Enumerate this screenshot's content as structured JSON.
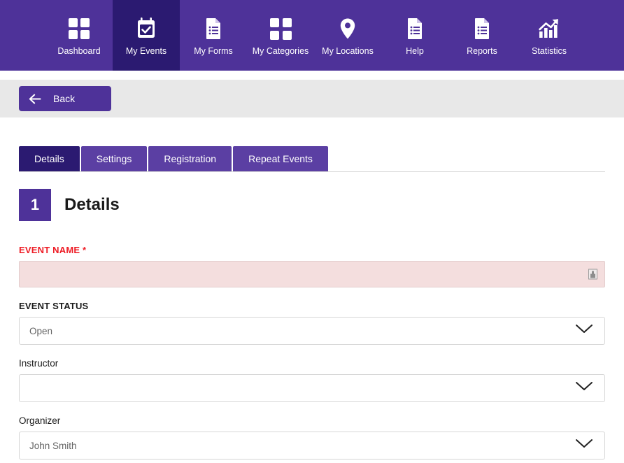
{
  "nav": {
    "items": [
      {
        "label": "Dashboard",
        "icon": "grid-icon",
        "active": false
      },
      {
        "label": "My Events",
        "icon": "calendar-check-icon",
        "active": true
      },
      {
        "label": "My Forms",
        "icon": "document-list-icon",
        "active": false
      },
      {
        "label": "My Categories",
        "icon": "grid-icon",
        "active": false
      },
      {
        "label": "My Locations",
        "icon": "map-pin-icon",
        "active": false
      },
      {
        "label": "Help",
        "icon": "document-list-icon",
        "active": false
      },
      {
        "label": "Reports",
        "icon": "document-list-icon",
        "active": false
      },
      {
        "label": "Statistics",
        "icon": "bar-chart-arrow-icon",
        "active": false
      }
    ]
  },
  "toolbar": {
    "back_label": "Back",
    "back_icon": "arrow-left-icon"
  },
  "tabs": [
    {
      "label": "Details",
      "active": true
    },
    {
      "label": "Settings",
      "active": false
    },
    {
      "label": "Registration",
      "active": false
    },
    {
      "label": "Repeat Events",
      "active": false
    }
  ],
  "section": {
    "number": "1",
    "title": "Details"
  },
  "form": {
    "event_name": {
      "label": "EVENT NAME",
      "required_marker": "*",
      "value": "",
      "placeholder": "",
      "icon": "image-placeholder-icon"
    },
    "event_status": {
      "label": "EVENT STATUS",
      "value": "Open",
      "icon": "chevron-down-icon"
    },
    "instructor": {
      "label": "Instructor",
      "value": "",
      "icon": "chevron-down-icon"
    },
    "organizer": {
      "label": "Organizer",
      "value": "John Smith",
      "icon": "chevron-down-icon"
    }
  },
  "colors": {
    "nav_purple": "#4e3299",
    "active_purple": "#2b1a71",
    "tab_purple": "#5b3fa3",
    "toolbar_gray": "#e8e8e8",
    "error_red": "#ee1c25",
    "error_field_bg": "#f4dede"
  }
}
